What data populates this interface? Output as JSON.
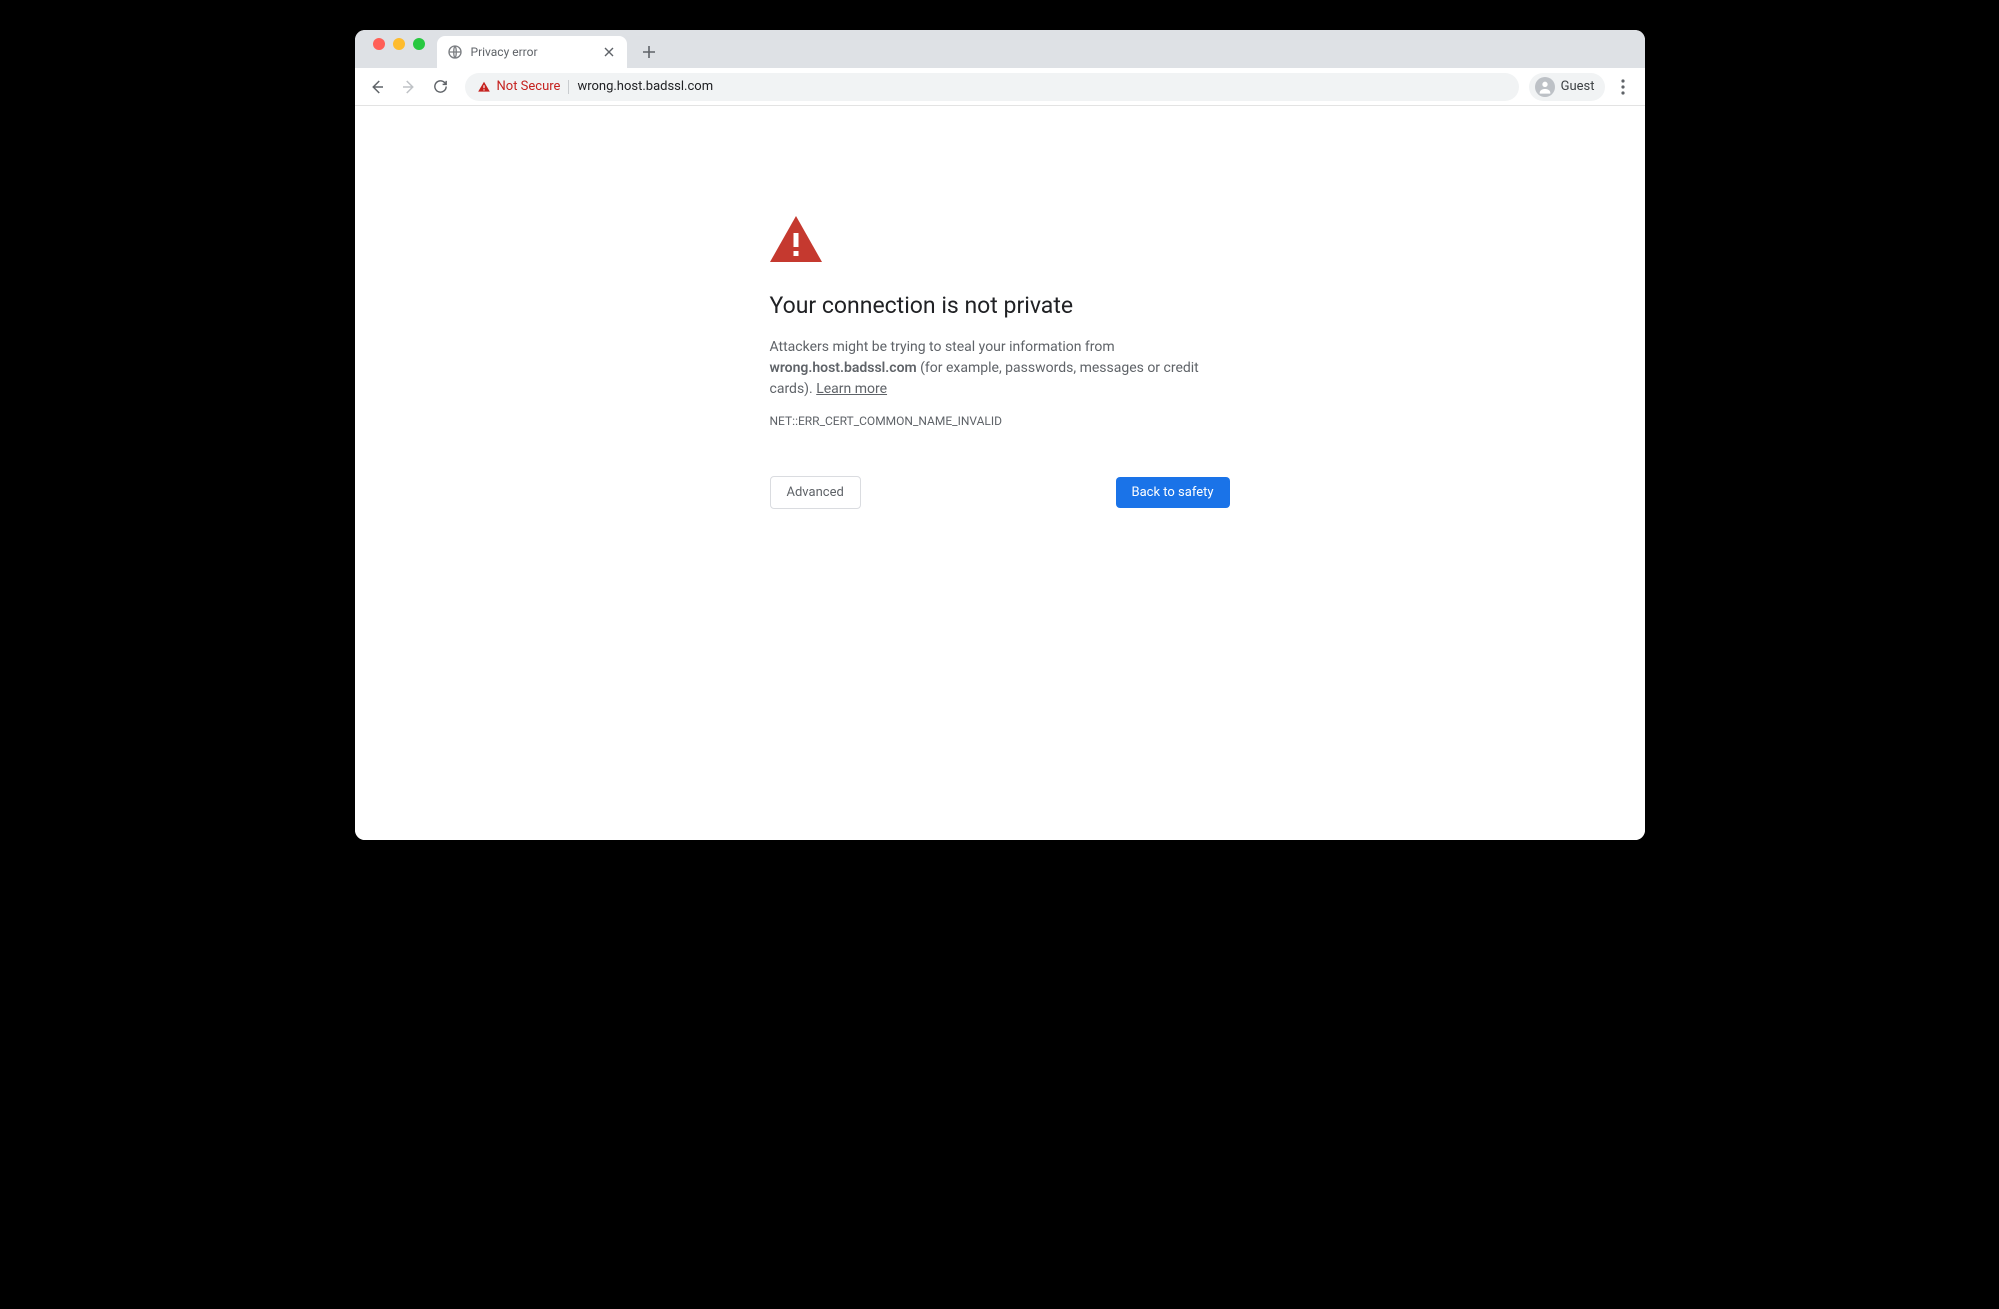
{
  "tab": {
    "title": "Privacy error"
  },
  "toolbar": {
    "security_label": "Not Secure",
    "url": "wrong.host.badssl.com",
    "guest_label": "Guest"
  },
  "page": {
    "heading": "Your connection is not private",
    "body_prefix": "Attackers might be trying to steal your information from ",
    "body_host": "wrong.host.badssl.com",
    "body_suffix": " (for example, passwords, messages or credit cards). ",
    "learn_more": "Learn more",
    "error_code": "NET::ERR_CERT_COMMON_NAME_INVALID",
    "advanced_label": "Advanced",
    "back_label": "Back to safety"
  }
}
